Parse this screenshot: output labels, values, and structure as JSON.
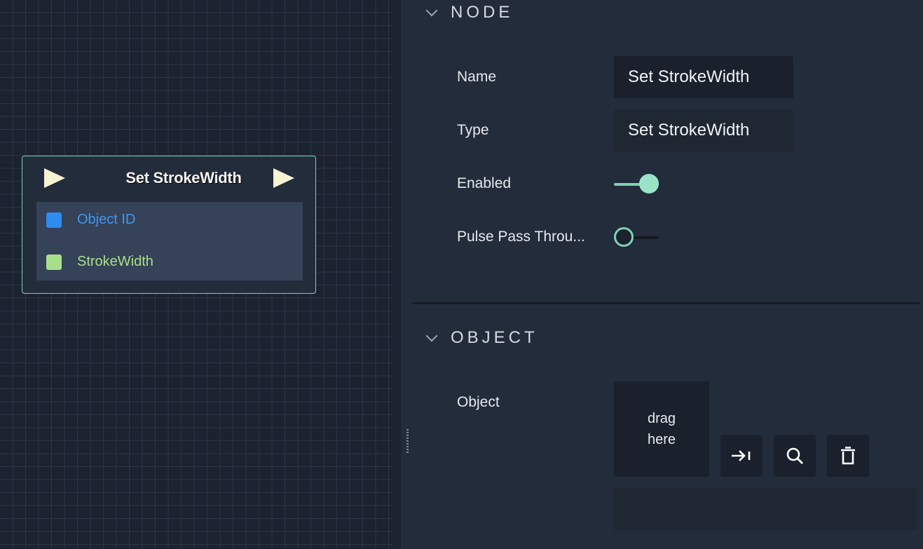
{
  "graph": {
    "node": {
      "title": "Set StrokeWidth",
      "ports": [
        {
          "label": "Object ID",
          "color": "#2d8cf0"
        },
        {
          "label": "StrokeWidth",
          "color": "#a7e08a"
        }
      ],
      "border_color": "#7fd1b2"
    }
  },
  "inspector": {
    "node_section": {
      "title": "NODE",
      "rows": {
        "name": {
          "label": "Name",
          "value": "Set StrokeWidth"
        },
        "type": {
          "label": "Type",
          "value": "Set StrokeWidth"
        },
        "enabled": {
          "label": "Enabled",
          "state": "on"
        },
        "pulse": {
          "label": "Pulse Pass Throu...",
          "state": "off"
        }
      }
    },
    "object_section": {
      "title": "OBJECT",
      "object_label": "Object",
      "drop_line1": "drag",
      "drop_line2": "here",
      "buttons": [
        "jump-to-icon",
        "search-icon",
        "trash-icon"
      ]
    }
  },
  "colors": {
    "accent": "#7fd1b2",
    "background": "#222c3b"
  }
}
